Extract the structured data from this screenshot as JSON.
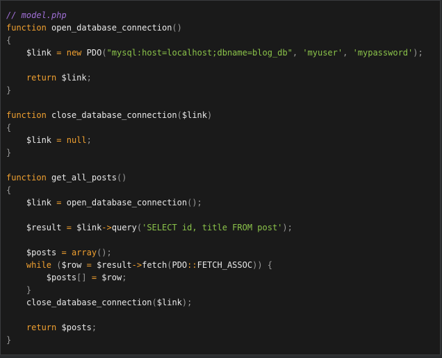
{
  "colors": {
    "background": "#1a1a1a",
    "comment": "#a06fd6",
    "keyword": "#f0a030",
    "string": "#8bc34a",
    "punctuation": "#9a9a9a",
    "text": "#e8e8e8"
  },
  "code": {
    "l1": {
      "comment": "// model.php"
    },
    "l2": {
      "kw": "function",
      "name": " open_database_connection",
      "p": "()"
    },
    "l3": {
      "p": "{"
    },
    "l4": {
      "ind": "    ",
      "var": "$link",
      "eq": " = ",
      "kw": "new",
      "cls": " PDO",
      "p1": "(",
      "s1": "\"mysql:host=localhost;dbname=blog_db\"",
      "c1": ", ",
      "s2": "'myuser'",
      "c2": ", ",
      "s3": "'mypassword'",
      "p2": ");"
    },
    "l5": {},
    "l6": {
      "ind": "    ",
      "kw": "return",
      "var": " $link",
      "p": ";"
    },
    "l7": {
      "p": "}"
    },
    "l8": {},
    "l9": {
      "kw": "function",
      "name": " close_database_connection",
      "p1": "(",
      "var": "$link",
      "p2": ")"
    },
    "l10": {
      "p": "{"
    },
    "l11": {
      "ind": "    ",
      "var": "$link",
      "eq": " = ",
      "kw": "null",
      "p": ";"
    },
    "l12": {
      "p": "}"
    },
    "l13": {},
    "l14": {
      "kw": "function",
      "name": " get_all_posts",
      "p": "()"
    },
    "l15": {
      "p": "{"
    },
    "l16": {
      "ind": "    ",
      "var": "$link",
      "eq": " = ",
      "fn": "open_database_connection",
      "p": "();"
    },
    "l17": {},
    "l18": {
      "ind": "    ",
      "var": "$result",
      "eq": " = ",
      "var2": "$link",
      "arrow": "->",
      "fn": "query",
      "p1": "(",
      "s": "'SELECT id, title FROM post'",
      "p2": ");"
    },
    "l19": {},
    "l20": {
      "ind": "    ",
      "var": "$posts",
      "eq": " = ",
      "kw": "array",
      "p": "();"
    },
    "l21": {
      "ind": "    ",
      "kw": "while",
      "p1": " (",
      "var": "$row",
      "eq": " = ",
      "var2": "$result",
      "arrow": "->",
      "fn": "fetch",
      "p2": "(",
      "cls": "PDO",
      "dc": "::",
      "const": "FETCH_ASSOC",
      "p3": ")) {"
    },
    "l22": {
      "ind": "        ",
      "var": "$posts",
      "br": "[]",
      "eq": " = ",
      "var2": "$row",
      "p": ";"
    },
    "l23": {
      "ind": "    ",
      "p": "}"
    },
    "l24": {
      "ind": "    ",
      "fn": "close_database_connection",
      "p1": "(",
      "var": "$link",
      "p2": ");"
    },
    "l25": {},
    "l26": {
      "ind": "    ",
      "kw": "return",
      "var": " $posts",
      "p": ";"
    },
    "l27": {
      "p": "}"
    }
  }
}
